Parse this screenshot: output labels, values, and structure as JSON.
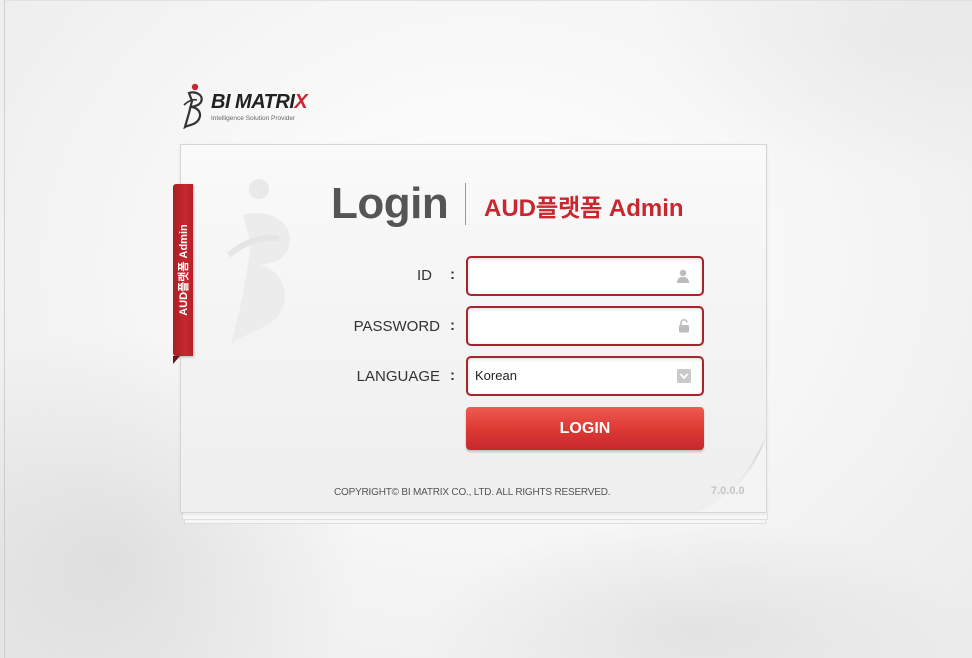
{
  "brand": {
    "name_main": "BI MATRI",
    "name_accent": "X",
    "tagline": "Intelligence Solution Provider"
  },
  "side_tab": {
    "label": "AUD플랫폼 Admin"
  },
  "header": {
    "title": "Login",
    "app_name": "AUD플랫폼 Admin"
  },
  "form": {
    "id": {
      "label": "ID",
      "colon": ":",
      "value": "",
      "icon": "user-icon"
    },
    "password": {
      "label": "PASSWORD",
      "colon": ":",
      "value": "",
      "icon": "lock-icon"
    },
    "language": {
      "label": "LANGUAGE",
      "colon": ":",
      "selected": "Korean",
      "icon": "dropdown-arrow-icon"
    },
    "submit_label": "LOGIN"
  },
  "footer": {
    "copyright": "COPYRIGHT© BI MATRIX CO., LTD.  ALL RIGHTS RESERVED.",
    "version": "7.0.0.0"
  },
  "colors": {
    "accent": "#c8272f",
    "field_border": "#a6242b",
    "button_top": "#ef5a52",
    "button_bottom": "#c8272f"
  }
}
